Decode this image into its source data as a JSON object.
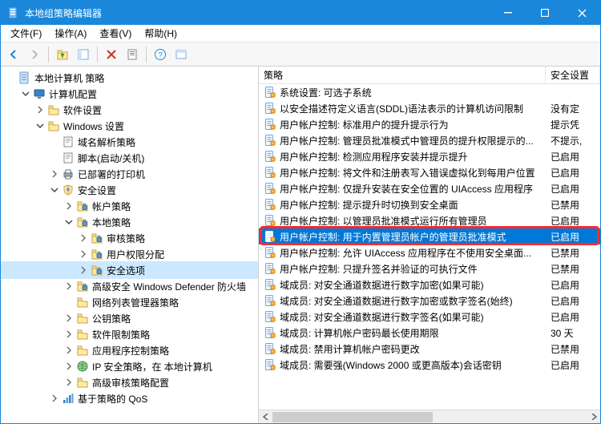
{
  "title": "本地组策略编辑器",
  "menus": [
    "文件(F)",
    "操作(A)",
    "查看(V)",
    "帮助(H)"
  ],
  "list": {
    "headers": [
      "策略",
      "安全设置"
    ],
    "rows": [
      {
        "t": "系统设置: 可选子系统",
        "v": ""
      },
      {
        "t": "以安全描述符定义语言(SDDL)语法表示的计算机访问限制",
        "v": "没有定"
      },
      {
        "t": "用户帐户控制: 标准用户的提升提示行为",
        "v": "提示凭"
      },
      {
        "t": "用户帐户控制: 管理员批准模式中管理员的提升权限提示的...",
        "v": "不提示,"
      },
      {
        "t": "用户帐户控制: 检测应用程序安装并提示提升",
        "v": "已启用"
      },
      {
        "t": "用户帐户控制: 将文件和注册表写入错误虚拟化到每用户位置",
        "v": "已启用"
      },
      {
        "t": "用户帐户控制: 仅提升安装在安全位置的 UIAccess 应用程序",
        "v": "已启用"
      },
      {
        "t": "用户帐户控制: 提示提升时切换到安全桌面",
        "v": "已禁用"
      },
      {
        "t": "用户帐户控制: 以管理员批准模式运行所有管理员",
        "v": "已启用"
      },
      {
        "t": "用户帐户控制: 用于内置管理员帐户的管理员批准模式",
        "v": "已启用",
        "selected": true
      },
      {
        "t": "用户帐户控制: 允许 UIAccess 应用程序在不使用安全桌面...",
        "v": "已禁用"
      },
      {
        "t": "用户帐户控制: 只提升签名并验证的可执行文件",
        "v": "已禁用"
      },
      {
        "t": "域成员: 对安全通道数据进行数字加密(如果可能)",
        "v": "已启用"
      },
      {
        "t": "域成员: 对安全通道数据进行数字加密或数字签名(始终)",
        "v": "已启用"
      },
      {
        "t": "域成员: 对安全通道数据进行数字签名(如果可能)",
        "v": "已启用"
      },
      {
        "t": "域成员: 计算机帐户密码最长使用期限",
        "v": "30 天"
      },
      {
        "t": "域成员: 禁用计算机帐户密码更改",
        "v": "已禁用"
      },
      {
        "t": "域成员: 需要强(Windows 2000 或更高版本)会话密钥",
        "v": "已启用"
      }
    ]
  },
  "tree": [
    {
      "d": 0,
      "exp": "",
      "icon": "doc",
      "label": "本地计算机 策略"
    },
    {
      "d": 1,
      "exp": "open",
      "icon": "pc",
      "label": "计算机配置"
    },
    {
      "d": 2,
      "exp": "closed",
      "icon": "folder",
      "label": "软件设置"
    },
    {
      "d": 2,
      "exp": "open",
      "icon": "folder",
      "label": "Windows 设置"
    },
    {
      "d": 3,
      "exp": "",
      "icon": "script",
      "label": "域名解析策略"
    },
    {
      "d": 3,
      "exp": "",
      "icon": "script",
      "label": "脚本(启动/关机)"
    },
    {
      "d": 3,
      "exp": "closed",
      "icon": "printer",
      "label": "已部署的打印机"
    },
    {
      "d": 3,
      "exp": "open",
      "icon": "shield",
      "label": "安全设置"
    },
    {
      "d": 4,
      "exp": "closed",
      "icon": "lock",
      "label": "帐户策略"
    },
    {
      "d": 4,
      "exp": "open",
      "icon": "lock",
      "label": "本地策略"
    },
    {
      "d": 5,
      "exp": "closed",
      "icon": "lock",
      "label": "审核策略"
    },
    {
      "d": 5,
      "exp": "closed",
      "icon": "lock",
      "label": "用户权限分配"
    },
    {
      "d": 5,
      "exp": "closed",
      "icon": "lock",
      "label": "安全选项",
      "sel": true
    },
    {
      "d": 4,
      "exp": "closed",
      "icon": "lock",
      "label": "高级安全 Windows Defender 防火墙"
    },
    {
      "d": 4,
      "exp": "",
      "icon": "folder",
      "label": "网络列表管理器策略"
    },
    {
      "d": 4,
      "exp": "closed",
      "icon": "folder",
      "label": "公钥策略"
    },
    {
      "d": 4,
      "exp": "closed",
      "icon": "folder",
      "label": "软件限制策略"
    },
    {
      "d": 4,
      "exp": "closed",
      "icon": "folder",
      "label": "应用程序控制策略"
    },
    {
      "d": 4,
      "exp": "closed",
      "icon": "ip",
      "label": "IP 安全策略，在 本地计算机"
    },
    {
      "d": 4,
      "exp": "closed",
      "icon": "folder",
      "label": "高级审核策略配置"
    },
    {
      "d": 3,
      "exp": "closed",
      "icon": "qos",
      "label": "基于策略的 QoS"
    }
  ]
}
